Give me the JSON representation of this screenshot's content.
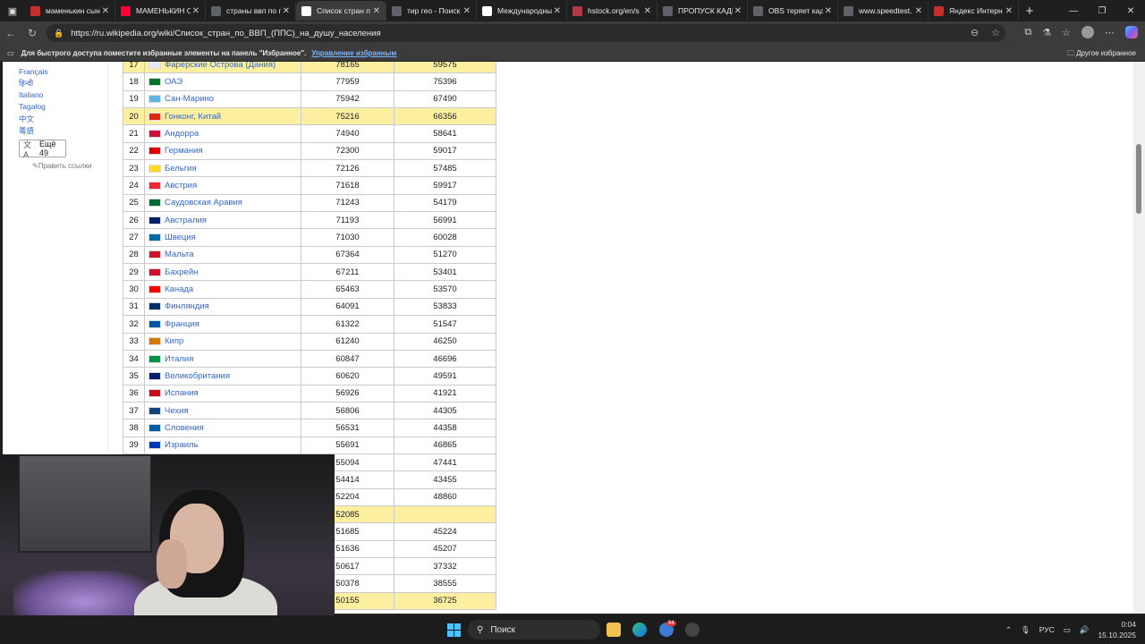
{
  "tabs": [
    {
      "title": "маменькин сын",
      "fav_color": "#c4302b",
      "active": false
    },
    {
      "title": "МАМЕНЬКИН С",
      "fav_color": "#ff0033",
      "active": false
    },
    {
      "title": "страны ввп по п",
      "fav_color": "#5f6368",
      "active": false
    },
    {
      "title": "Список стран п",
      "fav_color": "#ffffff",
      "active": true
    },
    {
      "title": "тир гео - Поиск",
      "fav_color": "#5f6368",
      "active": false
    },
    {
      "title": "Международны",
      "fav_color": "#ffffff",
      "active": false
    },
    {
      "title": "hstock.org/en/s",
      "fav_color": "#b03a48",
      "active": false
    },
    {
      "title": "ПРОПУСК КАДР",
      "fav_color": "#5f6368",
      "active": false
    },
    {
      "title": "OBS теряет кад",
      "fav_color": "#5f6368",
      "active": false
    },
    {
      "title": "www.speedtest.",
      "fav_color": "#5f6368",
      "active": false
    },
    {
      "title": "Яндекс Интерн",
      "fav_color": "#c4302b",
      "active": false
    }
  ],
  "address": {
    "url": "https://ru.wikipedia.org/wiki/Список_стран_по_ВВП_(ППС)_на_душу_населения"
  },
  "favbar": {
    "hint": "Для быстрого доступа поместите избранные элементы на панель \"Избранное\".",
    "manage": "Управление избранным",
    "other": "Другое избранное"
  },
  "sidebar": {
    "languages": [
      "Français",
      "हिन्दी",
      "Italiano",
      "Tagalog",
      "中文",
      "粵語"
    ],
    "more": "Ещё 49",
    "edit": "Править ссылки"
  },
  "table": {
    "rows": [
      {
        "rank": "17",
        "name": "Фарерские Острова (Дания)",
        "v1": "78165",
        "v2": "59575",
        "hl": true,
        "flag": "#e8e8f8"
      },
      {
        "rank": "18",
        "name": "ОАЭ",
        "v1": "77959",
        "v2": "75396",
        "hl": false,
        "flag": "#00732f"
      },
      {
        "rank": "19",
        "name": "Сан-Марино",
        "v1": "75942",
        "v2": "67490",
        "hl": false,
        "flag": "#5eb6e4"
      },
      {
        "rank": "20",
        "name": "Гонконг, Китай",
        "v1": "75216",
        "v2": "66356",
        "hl": true,
        "flag": "#de2910"
      },
      {
        "rank": "21",
        "name": "Андорра",
        "v1": "74940",
        "v2": "58641",
        "hl": false,
        "flag": "#d0103a"
      },
      {
        "rank": "22",
        "name": "Германия",
        "v1": "72300",
        "v2": "59017",
        "hl": false,
        "flag": "#dd0000"
      },
      {
        "rank": "23",
        "name": "Бельгия",
        "v1": "72126",
        "v2": "57485",
        "hl": false,
        "flag": "#fdda24"
      },
      {
        "rank": "24",
        "name": "Австрия",
        "v1": "71618",
        "v2": "59917",
        "hl": false,
        "flag": "#ed2939"
      },
      {
        "rank": "25",
        "name": "Саудовская Аравия",
        "v1": "71243",
        "v2": "54179",
        "hl": false,
        "flag": "#006c35"
      },
      {
        "rank": "26",
        "name": "Австралия",
        "v1": "71193",
        "v2": "56991",
        "hl": false,
        "flag": "#012169"
      },
      {
        "rank": "27",
        "name": "Швеция",
        "v1": "71030",
        "v2": "60028",
        "hl": false,
        "flag": "#006aa7"
      },
      {
        "rank": "28",
        "name": "Мальта",
        "v1": "67364",
        "v2": "51270",
        "hl": false,
        "flag": "#cf142b"
      },
      {
        "rank": "29",
        "name": "Бахрейн",
        "v1": "67211",
        "v2": "53401",
        "hl": false,
        "flag": "#ce1126"
      },
      {
        "rank": "30",
        "name": "Канада",
        "v1": "65463",
        "v2": "53570",
        "hl": false,
        "flag": "#ff0000"
      },
      {
        "rank": "31",
        "name": "Финляндия",
        "v1": "64091",
        "v2": "53833",
        "hl": false,
        "flag": "#002f6c"
      },
      {
        "rank": "32",
        "name": "Франция",
        "v1": "61322",
        "v2": "51547",
        "hl": false,
        "flag": "#0055a4"
      },
      {
        "rank": "33",
        "name": "Кипр",
        "v1": "61240",
        "v2": "46250",
        "hl": false,
        "flag": "#d57800"
      },
      {
        "rank": "34",
        "name": "Италия",
        "v1": "60847",
        "v2": "46696",
        "hl": false,
        "flag": "#009246"
      },
      {
        "rank": "35",
        "name": "Великобритания",
        "v1": "60620",
        "v2": "49591",
        "hl": false,
        "flag": "#012169"
      },
      {
        "rank": "36",
        "name": "Испания",
        "v1": "56926",
        "v2": "41921",
        "hl": false,
        "flag": "#c60b1e"
      },
      {
        "rank": "37",
        "name": "Чехия",
        "v1": "56806",
        "v2": "44305",
        "hl": false,
        "flag": "#11457e"
      },
      {
        "rank": "38",
        "name": "Словения",
        "v1": "56531",
        "v2": "44358",
        "hl": false,
        "flag": "#005da4"
      },
      {
        "rank": "39",
        "name": "Израиль",
        "v1": "55691",
        "v2": "46865",
        "hl": false,
        "flag": "#0038b8"
      },
      {
        "rank": "",
        "name": "",
        "v1": "55094",
        "v2": "47441",
        "hl": false,
        "flag": ""
      },
      {
        "rank": "",
        "name": "",
        "v1": "54414",
        "v2": "43455",
        "hl": false,
        "flag": ""
      },
      {
        "rank": "",
        "name": "",
        "v1": "52204",
        "v2": "48860",
        "hl": false,
        "flag": ""
      },
      {
        "rank": "",
        "name": "",
        "v1": "52085",
        "v2": "",
        "hl": true,
        "flag": ""
      },
      {
        "rank": "",
        "name": "",
        "v1": "51685",
        "v2": "45224",
        "hl": false,
        "flag": ""
      },
      {
        "rank": "",
        "name": "",
        "v1": "51636",
        "v2": "45207",
        "hl": false,
        "flag": ""
      },
      {
        "rank": "",
        "name": "",
        "v1": "50617",
        "v2": "37332",
        "hl": false,
        "flag": ""
      },
      {
        "rank": "",
        "name": "",
        "v1": "50378",
        "v2": "38555",
        "hl": false,
        "flag": ""
      },
      {
        "rank": "",
        "name": "",
        "v1": "50155",
        "v2": "36725",
        "hl": true,
        "flag": ""
      }
    ]
  },
  "taskbar": {
    "search": "Поиск",
    "lang": "РУС",
    "time": "0:04",
    "date": "15.10.2025",
    "badge": "94"
  }
}
